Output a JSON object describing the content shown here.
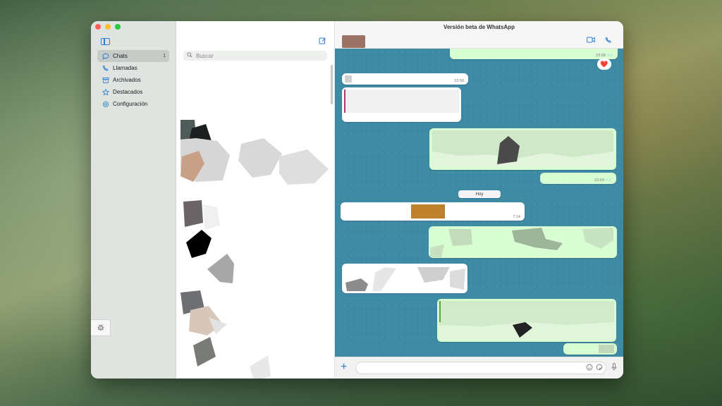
{
  "window": {
    "title": "Versión beta de WhatsApp"
  },
  "sidebar": {
    "items": [
      {
        "label": "Chats",
        "count": "1",
        "icon": "chat-bubble-icon",
        "active": true
      },
      {
        "label": "Llamadas",
        "icon": "phone-icon"
      },
      {
        "label": "Archivados",
        "icon": "archive-icon"
      },
      {
        "label": "Destacados",
        "icon": "star-icon"
      },
      {
        "label": "Configuración",
        "icon": "gear-icon"
      }
    ]
  },
  "chatlist": {
    "search_placeholder": "Buscar"
  },
  "chat": {
    "messages": [
      {
        "time": "23:58"
      },
      {
        "time": "23:58"
      },
      {
        "time": "23:59"
      },
      {
        "time": "7:14"
      }
    ],
    "date_separator": "Hoy",
    "reaction": "❤️"
  },
  "composer": {
    "placeholder": ""
  },
  "colors": {
    "accent": "#2a7fd4",
    "outgoing": "#d9fdd3",
    "chat_bg": "#3d8aa5"
  }
}
